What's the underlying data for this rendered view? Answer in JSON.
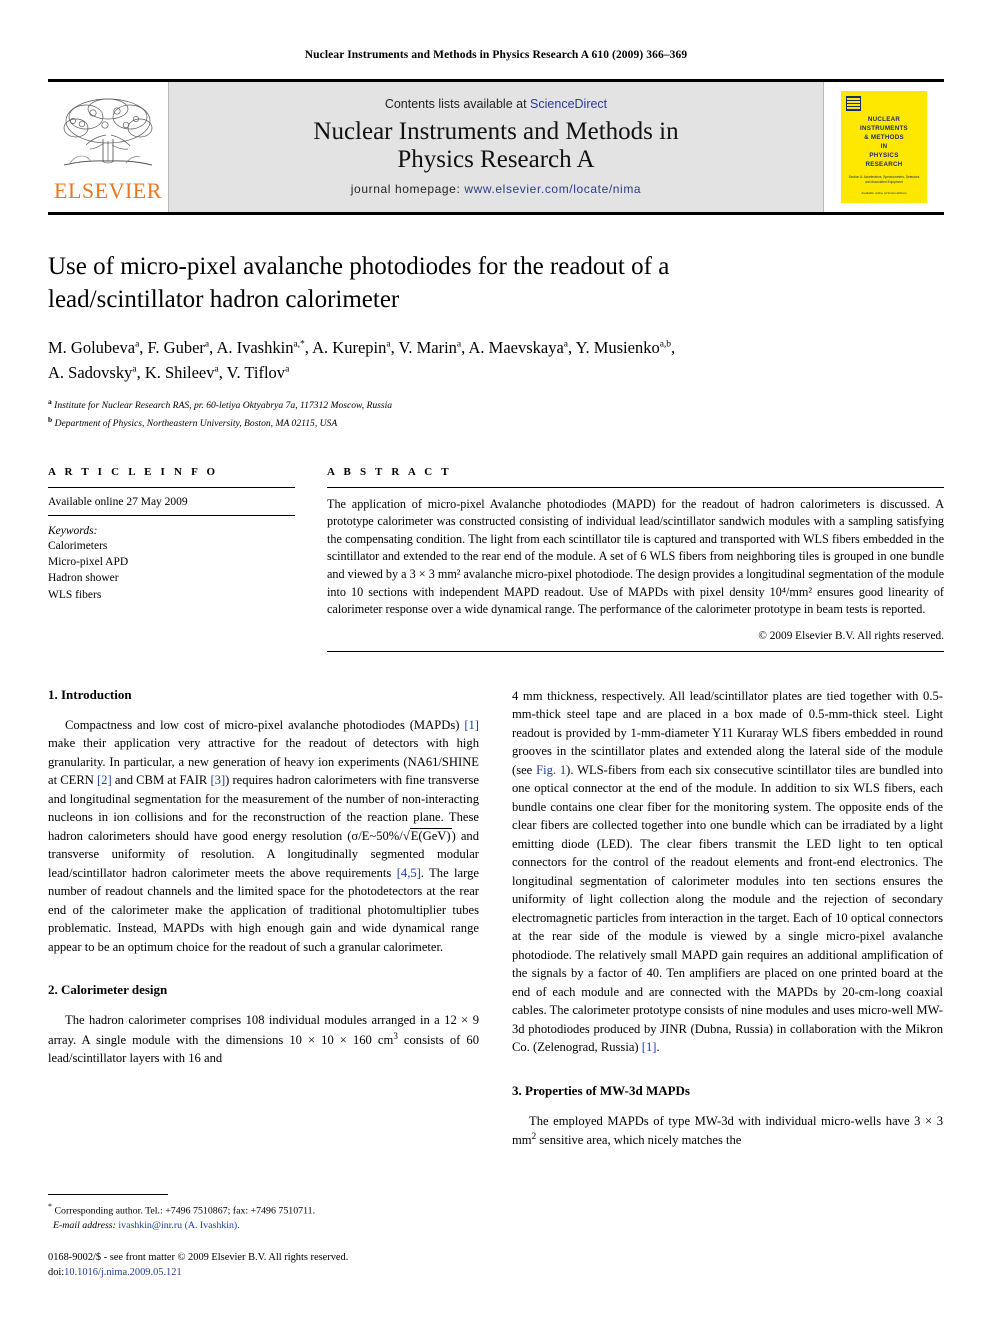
{
  "running_head": "Nuclear Instruments and Methods in Physics Research A 610 (2009) 366–369",
  "masthead": {
    "publisher_logo_text": "ELSEVIER",
    "contents_prefix": "Contents lists available at",
    "contents_link": "ScienceDirect",
    "journal_title_line1": "Nuclear Instruments and Methods in",
    "journal_title_line2": "Physics Research A",
    "homepage_prefix": "journal homepage:",
    "homepage_url": "www.elsevier.com/locate/nima",
    "cover": {
      "title_line1": "NUCLEAR",
      "title_line2": "INSTRUMENTS",
      "title_line3": "& METHODS",
      "title_line4": "IN",
      "title_line5": "PHYSICS",
      "title_line6": "RESEARCH",
      "subtitle": "Section A: Accelerators, Spectrometers, Detectors and Associated Equipment",
      "footer": "Available online at ScienceDirect"
    },
    "accent_color": "#E87722",
    "link_color": "#2b3b8f",
    "band_color": "#e3e3e3",
    "cover_color": "#FFE800"
  },
  "article": {
    "title_line1": "Use of micro-pixel avalanche photodiodes for the readout of a",
    "title_line2": "lead/scintillator hadron calorimeter",
    "authors_line1": "M. Golubeva a, F. Guber a, A. Ivashkin a,*, A. Kurepin a, V. Marin a, A. Maevskaya a, Y. Musienko a,b,",
    "authors_line2": "A. Sadovsky a, K. Shileev a, V. Tiflov a",
    "affiliation_a": "Institute for Nuclear Research RAS, pr. 60-letiya Oktyabrya 7a, 117312 Moscow, Russia",
    "affiliation_b": "Department of Physics, Northeastern University, Boston, MA 02115, USA"
  },
  "article_info": {
    "heading": "A R T I C L E    I N F O",
    "available_online": "Available online 27 May 2009",
    "keywords_label": "Keywords:",
    "keywords": [
      "Calorimeters",
      "Micro-pixel APD",
      "Hadron shower",
      "WLS fibers"
    ]
  },
  "abstract": {
    "heading": "A B S T R A C T",
    "text": "The application of micro-pixel Avalanche photodiodes (MAPD) for the readout of hadron calorimeters is discussed. A prototype calorimeter was constructed consisting of individual lead/scintillator sandwich modules with a sampling satisfying the compensating condition. The light from each scintillator tile is captured and transported with WLS fibers embedded in the scintillator and extended to the rear end of the module. A set of 6 WLS fibers from neighboring tiles is grouped in one bundle and viewed by a 3 × 3 mm² avalanche micro-pixel photodiode. The design provides a longitudinal segmentation of the module into 10 sections with independent MAPD readout. Use of MAPDs with pixel density 10⁴/mm² ensures good linearity of calorimeter response over a wide dynamical range. The performance of the calorimeter prototype in beam tests is reported.",
    "copyright": "© 2009 Elsevier B.V. All rights reserved."
  },
  "sections": {
    "intro_heading": "1.  Introduction",
    "intro_p1_a": "Compactness and low cost of micro-pixel avalanche photodiodes (MAPDs) ",
    "intro_ref1": "[1]",
    "intro_p1_b": " make their application very attractive for the readout of detectors with high granularity. In particular, a new generation of heavy ion experiments (NA61/SHINE at CERN ",
    "intro_ref2": "[2]",
    "intro_p1_c": " and CBM at FAIR ",
    "intro_ref3": "[3]",
    "intro_p1_d": ") requires hadron calorimeters with fine transverse and longitudinal segmentation for the measurement of the number of non-interacting nucleons in ion collisions and for the reconstruction of the reaction plane. These hadron calorimeters should have good energy resolution (σ/E~50%/",
    "intro_sqrt": "E(GeV)",
    "intro_p1_e": ") and transverse uniformity of resolution. A longitudinally segmented modular lead/scintillator hadron calorimeter meets the above requirements ",
    "intro_ref45": "[4,5]",
    "intro_p1_f": ". The large number of readout channels and the limited space for the photodetectors at the rear end of the calorimeter make the application of traditional photomultiplier tubes problematic. Instead, MAPDs with high enough gain and wide dynamical range appear to be an optimum choice for the readout of such a granular calorimeter.",
    "design_heading": "2.  Calorimeter design",
    "design_p1_a": "The hadron calorimeter comprises 108 individual modules arranged in a 12 × 9 array. A single module with the dimensions 10 × 10 × 160 cm",
    "design_p1_sup": "3",
    "design_p1_b": " consists of 60 lead/scintillator layers with 16 and",
    "right_p1_a": "4 mm thickness, respectively. All lead/scintillator plates are tied together with 0.5-mm-thick steel tape and are placed in a box made of 0.5-mm-thick steel. Light readout is provided by 1-mm-diameter Y11 Kuraray WLS fibers embedded in round grooves in the scintillator plates and extended along the lateral side of the module (see ",
    "right_fig_ref": "Fig. 1",
    "right_p1_b": "). WLS-fibers from each six consecutive scintillator tiles are bundled into one optical connector at the end of the module. In addition to six WLS fibers, each bundle contains one clear fiber for the monitoring system. The opposite ends of the clear fibers are collected together into one bundle which can be irradiated by a light emitting diode (LED). The clear fibers transmit the LED light to ten optical connectors for the control of the readout elements and front-end electronics. The longitudinal segmentation of calorimeter modules into ten sections ensures the uniformity of light collection along the module and the rejection of secondary electromagnetic particles from interaction in the target. Each of 10 optical connectors at the rear side of the module is viewed by a single micro-pixel avalanche photodiode. The relatively small MAPD gain requires an additional amplification of the signals by a factor of 40. Ten amplifiers are placed on one printed board at the end of each module and are connected with the MAPDs by 20-cm-long coaxial cables. The calorimeter prototype consists of nine modules and uses micro-well MW-3d photodiodes produced by JINR (Dubna, Russia) in collaboration with the Mikron Co. (Zelenograd, Russia) ",
    "right_ref1": "[1]",
    "right_p1_c": ".",
    "props_heading": "3.  Properties of MW-3d MAPDs",
    "props_p1_a": "The employed MAPDs of type MW-3d with individual micro-wells have 3 × 3 mm",
    "props_p1_sup": "2",
    "props_p1_b": " sensitive area, which nicely matches the"
  },
  "footnote": {
    "corresponding": "Corresponding author. Tel.: +7496 7510867; fax: +7496 7510711.",
    "email_label": "E-mail address:",
    "email": "ivashkin@inr.ru",
    "email_owner": "(A. Ivashkin).",
    "issn_line": "0168-9002/$ - see front matter © 2009 Elsevier B.V. All rights reserved.",
    "doi_label": "doi:",
    "doi_value": "10.1016/j.nima.2009.05.121"
  }
}
